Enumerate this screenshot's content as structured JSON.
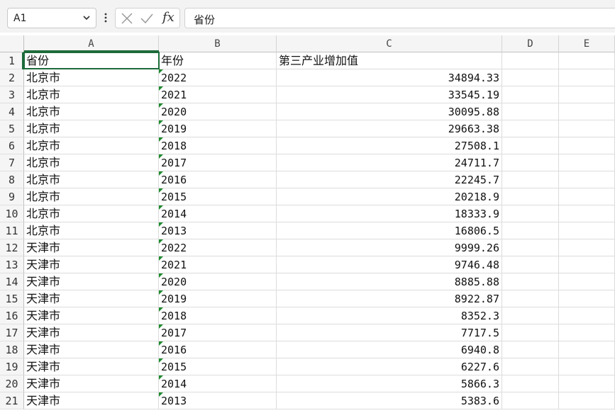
{
  "name_box": {
    "value": "A1"
  },
  "formula_bar": {
    "content": "省份",
    "fx_label": "fx"
  },
  "icons": {
    "cancel": "close-icon",
    "confirm": "check-icon",
    "dropdown": "chevron-down-icon",
    "more": "more-vertical-icon"
  },
  "accent_color": "#1e6b3a",
  "columns": [
    "A",
    "B",
    "C",
    "D",
    "E"
  ],
  "rows": [
    {
      "n": "1",
      "a": "省份",
      "b": "年份",
      "c": "第三产业增加值"
    },
    {
      "n": "2",
      "a": "北京市",
      "b": "2022",
      "c": "34894.33"
    },
    {
      "n": "3",
      "a": "北京市",
      "b": "2021",
      "c": "33545.19"
    },
    {
      "n": "4",
      "a": "北京市",
      "b": "2020",
      "c": "30095.88"
    },
    {
      "n": "5",
      "a": "北京市",
      "b": "2019",
      "c": "29663.38"
    },
    {
      "n": "6",
      "a": "北京市",
      "b": "2018",
      "c": "27508.1"
    },
    {
      "n": "7",
      "a": "北京市",
      "b": "2017",
      "c": "24711.7"
    },
    {
      "n": "8",
      "a": "北京市",
      "b": "2016",
      "c": "22245.7"
    },
    {
      "n": "9",
      "a": "北京市",
      "b": "2015",
      "c": "20218.9"
    },
    {
      "n": "10",
      "a": "北京市",
      "b": "2014",
      "c": "18333.9"
    },
    {
      "n": "11",
      "a": "北京市",
      "b": "2013",
      "c": "16806.5"
    },
    {
      "n": "12",
      "a": "天津市",
      "b": "2022",
      "c": "9999.26"
    },
    {
      "n": "13",
      "a": "天津市",
      "b": "2021",
      "c": "9746.48"
    },
    {
      "n": "14",
      "a": "天津市",
      "b": "2020",
      "c": "8885.88"
    },
    {
      "n": "15",
      "a": "天津市",
      "b": "2019",
      "c": "8922.87"
    },
    {
      "n": "16",
      "a": "天津市",
      "b": "2018",
      "c": "8352.3"
    },
    {
      "n": "17",
      "a": "天津市",
      "b": "2017",
      "c": "7717.5"
    },
    {
      "n": "18",
      "a": "天津市",
      "b": "2016",
      "c": "6940.8"
    },
    {
      "n": "19",
      "a": "天津市",
      "b": "2015",
      "c": "6227.6"
    },
    {
      "n": "20",
      "a": "天津市",
      "b": "2014",
      "c": "5866.3"
    },
    {
      "n": "21",
      "a": "天津市",
      "b": "2013",
      "c": "5383.6"
    }
  ]
}
